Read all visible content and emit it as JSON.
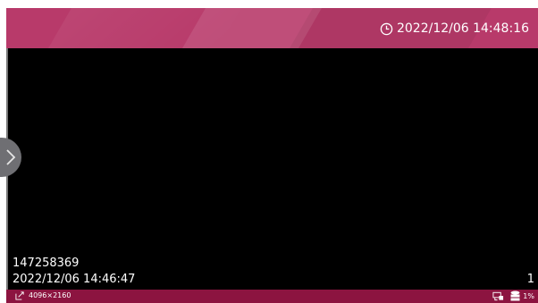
{
  "header": {
    "datetime": "2022/12/06 14:48:16",
    "clock_icon": "clock-icon"
  },
  "overlay": {
    "camera_id": "147258369",
    "record_time": "2022/12/06 14:46:47",
    "page_number": "1"
  },
  "footer": {
    "resolution": "4096×2160",
    "storage_percent": "1%",
    "icons": [
      "resolution-icon",
      "camera-lock-icon",
      "storage-icon"
    ]
  },
  "colors": {
    "header": "#b83a6a",
    "footer": "#8c1440",
    "video_bg": "#000000"
  }
}
